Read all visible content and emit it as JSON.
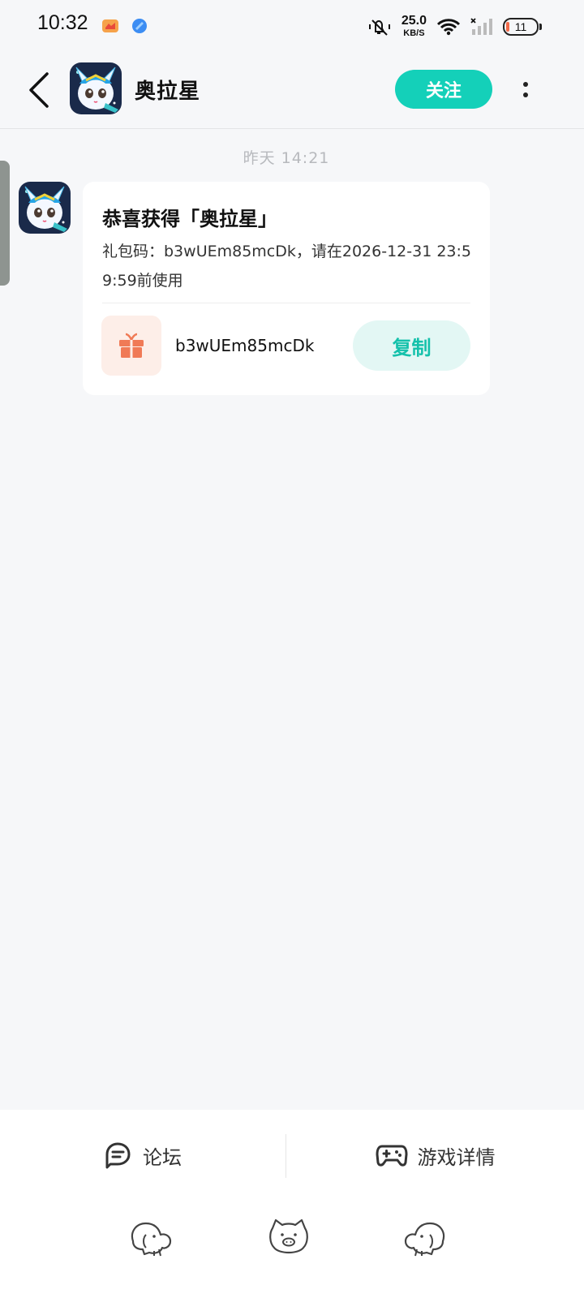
{
  "status_bar": {
    "time": "10:32",
    "net_speed_value": "25.0",
    "net_speed_unit": "KB/S",
    "battery": "11",
    "icons": [
      "notification-app-icon-1",
      "notification-app-icon-2",
      "mute-icon",
      "wifi-icon",
      "signal-icon",
      "battery-icon"
    ]
  },
  "header": {
    "title": "奥拉星",
    "follow_label": "关注",
    "icons": [
      "back-arrow-icon",
      "more-vertical-icon"
    ]
  },
  "chat": {
    "timestamp": "昨天 14:21",
    "card": {
      "title": "恭喜获得「奥拉星」",
      "description": "礼包码：b3wUEm85mcDk，请在2026-12-31 23:59:59前使用",
      "code": "b3wUEm85mcDk",
      "copy_label": "复制",
      "icon": "gift-icon"
    }
  },
  "bottom_bar": {
    "forum_label": "论坛",
    "game_detail_label": "游戏详情",
    "icons": [
      "forum-icon",
      "gamepad-icon",
      "mascot-elephant-icon",
      "mascot-pig-icon",
      "mascot-elephant-right-icon"
    ]
  },
  "colors": {
    "accent": "#14d0b9",
    "copy_bg": "#e3f7f4",
    "gift_bg": "#fdeee8",
    "gift": "#f07a56",
    "page_bg": "#f6f7f9"
  }
}
